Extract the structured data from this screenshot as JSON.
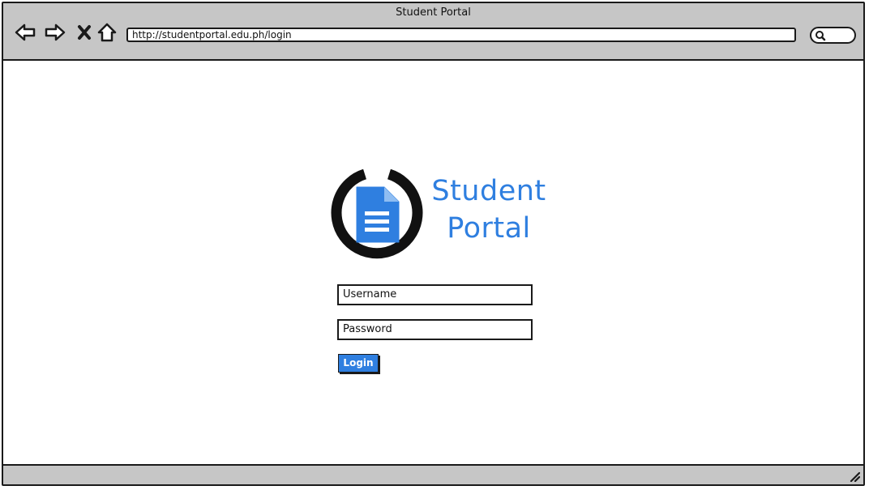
{
  "window": {
    "title": "Student Portal"
  },
  "toolbar": {
    "back_icon": "arrow-left-icon",
    "forward_icon": "arrow-right-icon",
    "stop_icon": "close-icon",
    "home_icon": "home-icon",
    "search_icon": "search-icon"
  },
  "address_bar": {
    "url": "http://studentportal.edu.ph/login"
  },
  "logo": {
    "line1": "Student",
    "line2": "Portal",
    "icon": "power-document-icon",
    "accent_color": "#2f7fe0"
  },
  "login_form": {
    "username_placeholder": "Username",
    "password_placeholder": "Password",
    "login_label": "Login"
  }
}
